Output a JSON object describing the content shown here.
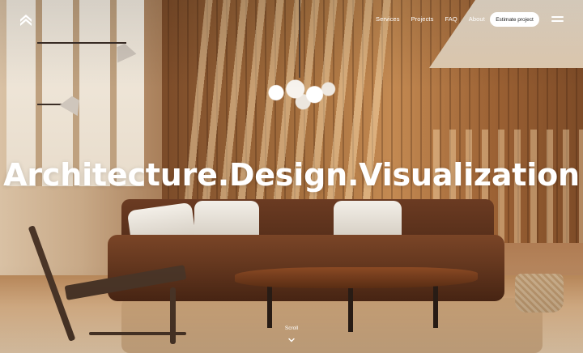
{
  "header": {
    "nav": [
      "Services",
      "Projects",
      "FAQ",
      "About"
    ],
    "cta_label": "Estimate project",
    "icons": {
      "logo": "house-logo-icon",
      "menu": "hamburger-menu-icon"
    }
  },
  "hero": {
    "title": "Architecture.Design.Visualization",
    "background": "interior-living-room-photo"
  },
  "scroll": {
    "label": "Scroll",
    "icon": "chevron-down-icon"
  },
  "colors": {
    "text": "#ffffff",
    "button_bg": "#ffffff",
    "button_text": "#1a1a1a"
  }
}
